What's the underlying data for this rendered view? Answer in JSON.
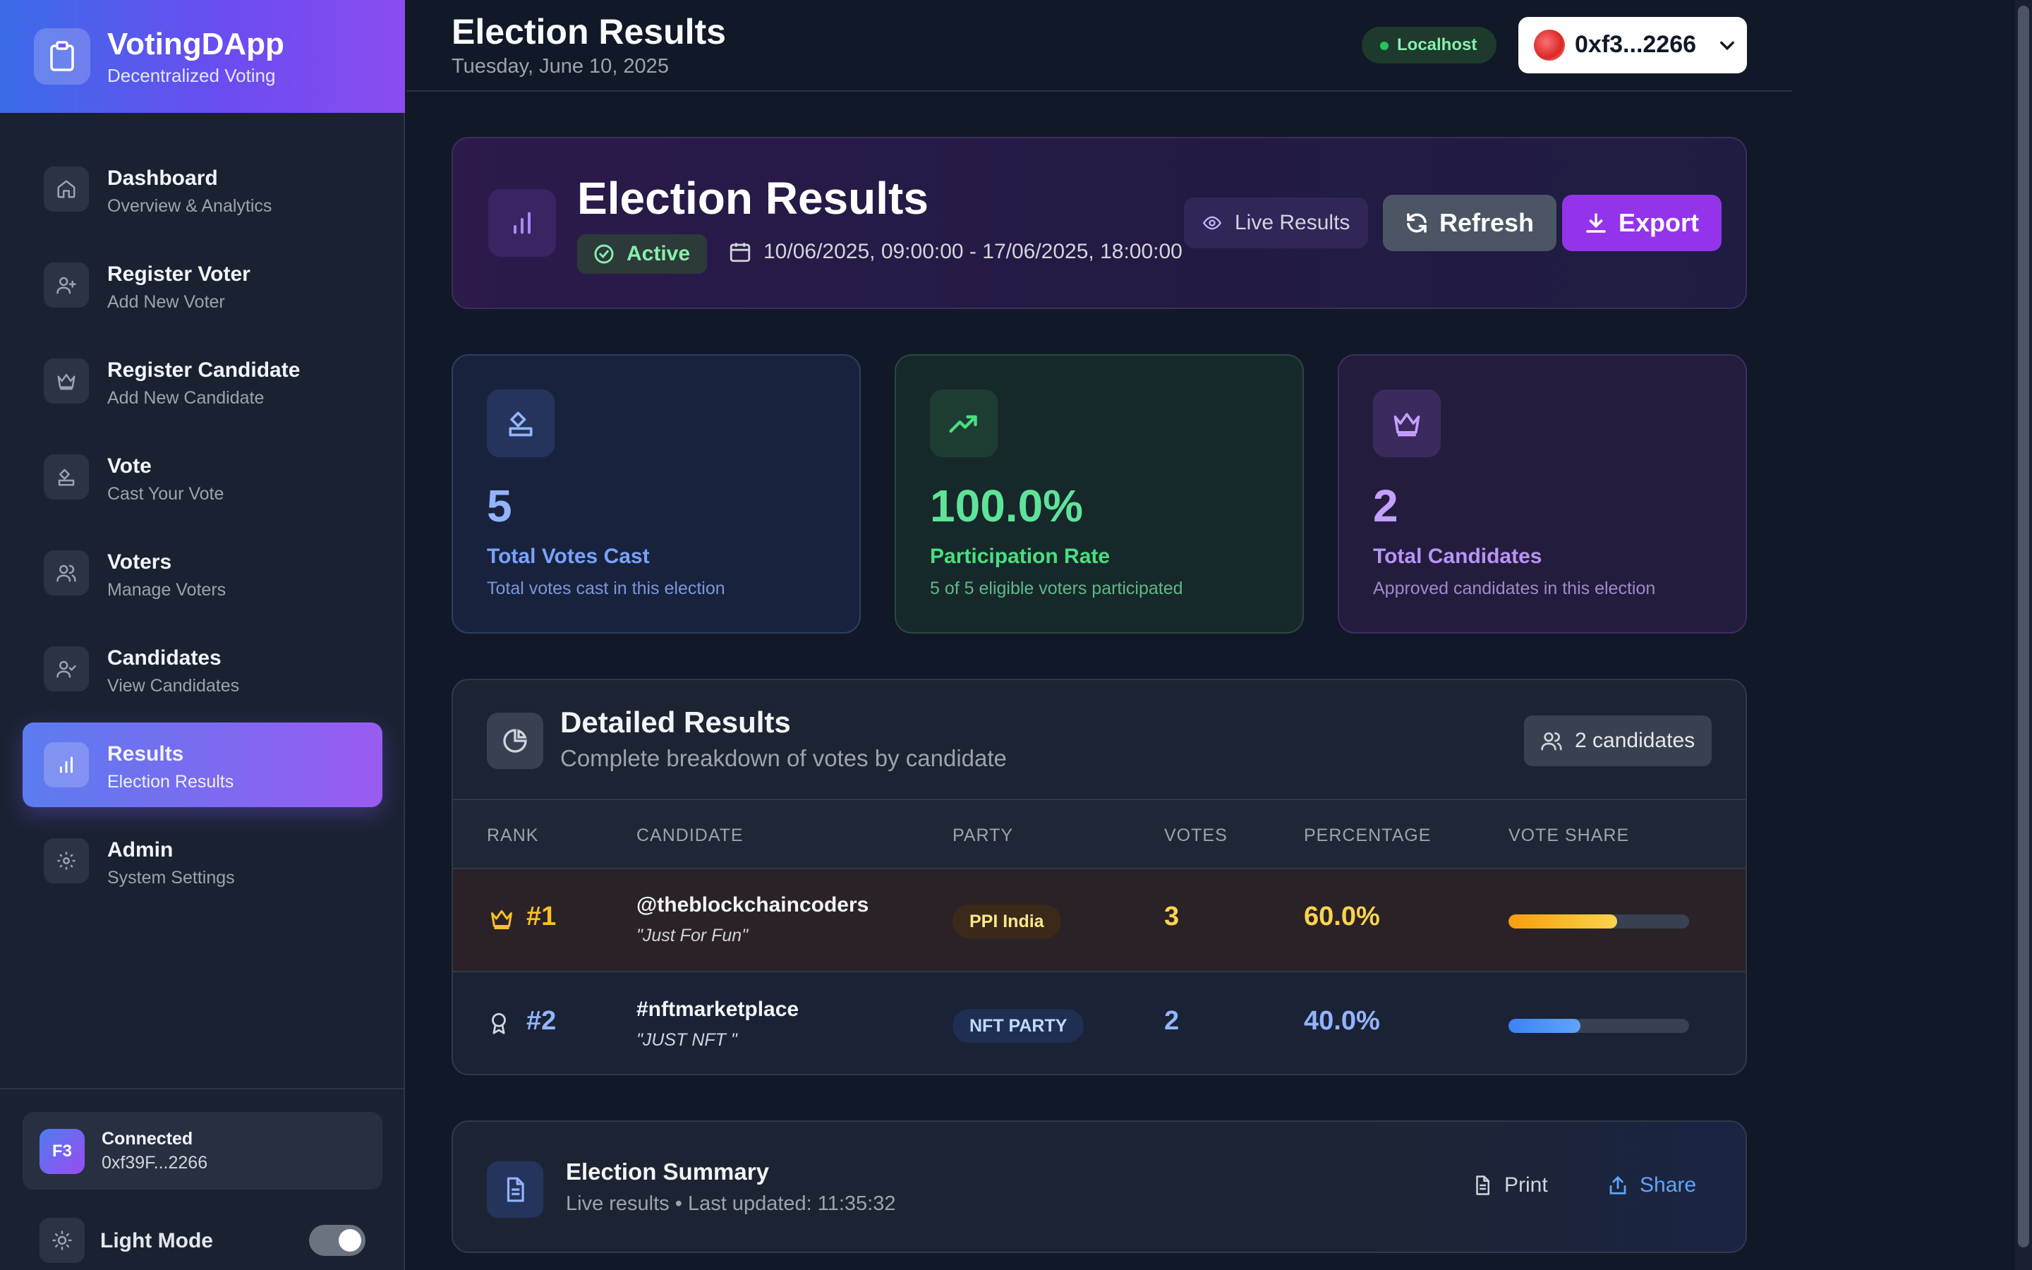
{
  "brand": {
    "title": "VotingDApp",
    "subtitle": "Decentralized Voting"
  },
  "sidebar": {
    "items": [
      {
        "label": "Dashboard",
        "sub": "Overview & Analytics",
        "icon": "home-icon"
      },
      {
        "label": "Register Voter",
        "sub": "Add New Voter",
        "icon": "user-plus-icon"
      },
      {
        "label": "Register Candidate",
        "sub": "Add New Candidate",
        "icon": "crown-icon"
      },
      {
        "label": "Vote",
        "sub": "Cast Your Vote",
        "icon": "ballot-icon"
      },
      {
        "label": "Voters",
        "sub": "Manage Voters",
        "icon": "users-icon"
      },
      {
        "label": "Candidates",
        "sub": "View Candidates",
        "icon": "user-check-icon"
      },
      {
        "label": "Results",
        "sub": "Election Results",
        "icon": "bar-chart-icon",
        "active": true
      },
      {
        "label": "Admin",
        "sub": "System Settings",
        "icon": "gear-icon"
      }
    ],
    "connection": {
      "avatar": "F3",
      "status": "Connected",
      "address": "0xf39F...2266"
    },
    "theme": {
      "label": "Light Mode"
    }
  },
  "header": {
    "title": "Election Results",
    "date": "Tuesday, June 10, 2025",
    "network": "Localhost",
    "wallet": "0xf3...2266"
  },
  "hero": {
    "title": "Election Results",
    "status": "Active",
    "date_range": "10/06/2025, 09:00:00 - 17/06/2025, 18:00:00",
    "live_label": "Live Results",
    "refresh_label": "Refresh",
    "export_label": "Export"
  },
  "stats": [
    {
      "value": "5",
      "label": "Total Votes Cast",
      "sub": "Total votes cast in this election"
    },
    {
      "value": "100.0%",
      "label": "Participation Rate",
      "sub": "5 of 5 eligible voters participated"
    },
    {
      "value": "2",
      "label": "Total Candidates",
      "sub": "Approved candidates in this election"
    }
  ],
  "results": {
    "title": "Detailed Results",
    "subtitle": "Complete breakdown of votes by candidate",
    "count": "2 candidates",
    "columns": [
      "RANK",
      "CANDIDATE",
      "PARTY",
      "VOTES",
      "PERCENTAGE",
      "VOTE SHARE"
    ],
    "rows": [
      {
        "rank": "#1",
        "name": "@theblockchaincoders",
        "slogan": "\"Just For Fun\"",
        "party": "PPI India",
        "votes": "3",
        "percentage": "60.0%",
        "share": 0.6
      },
      {
        "rank": "#2",
        "name": "#nftmarketplace",
        "slogan": "\"JUST NFT \"",
        "party": "NFT PARTY",
        "votes": "2",
        "percentage": "40.0%",
        "share": 0.4
      }
    ]
  },
  "summary": {
    "title": "Election Summary",
    "subtitle": "Live results • Last updated: 11:35:32",
    "print_label": "Print",
    "share_label": "Share"
  },
  "colors": {
    "accent": "#9333ea",
    "gold": "#fbbf24",
    "blue": "#60a5fa",
    "green": "#4ade80"
  }
}
